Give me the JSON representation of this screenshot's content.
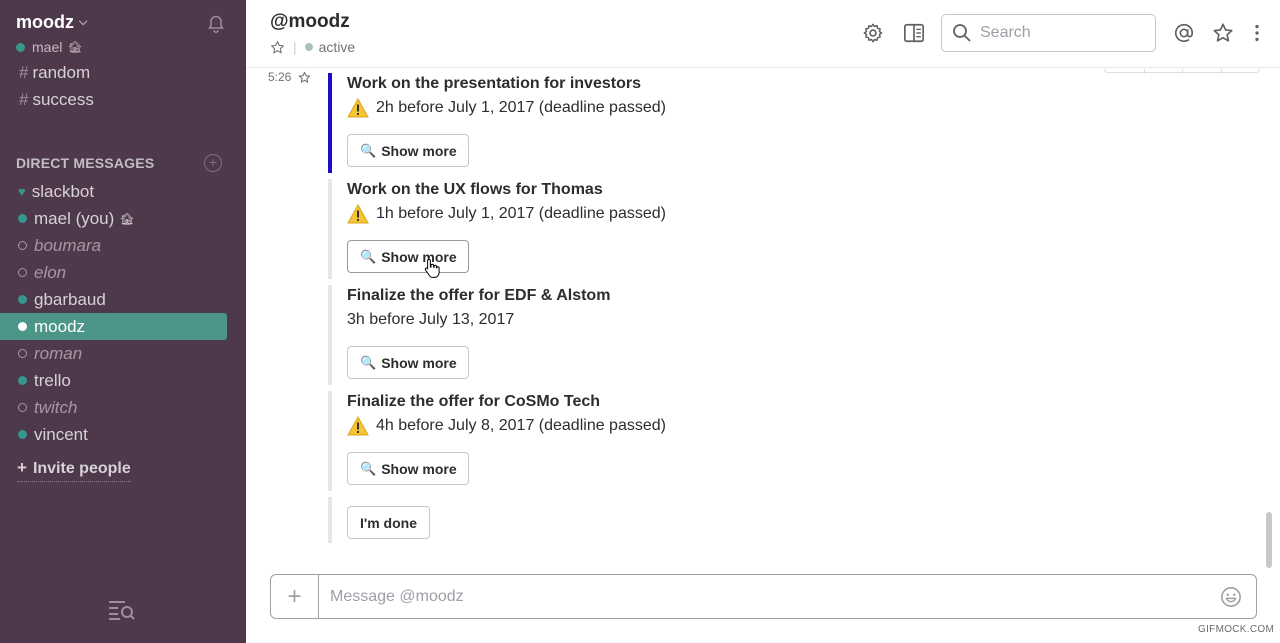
{
  "sidebar": {
    "team_name": "moodz",
    "user_name": "mael",
    "channels": [
      "random",
      "success"
    ],
    "section_title": "DIRECT MESSAGES",
    "dms": [
      {
        "name": "slackbot",
        "status": "bot"
      },
      {
        "name": "mael (you)",
        "status": "online"
      },
      {
        "name": "boumara",
        "status": "away"
      },
      {
        "name": "elon",
        "status": "away"
      },
      {
        "name": "gbarbaud",
        "status": "online"
      },
      {
        "name": "moodz",
        "status": "active"
      },
      {
        "name": "roman",
        "status": "away"
      },
      {
        "name": "trello",
        "status": "online"
      },
      {
        "name": "twitch",
        "status": "away"
      },
      {
        "name": "vincent",
        "status": "online"
      }
    ],
    "invite_label": "Invite people"
  },
  "header": {
    "title": "@moodz",
    "presence": "active",
    "search_placeholder": "Search"
  },
  "messages": {
    "timestamp": "5:26",
    "attachments": [
      {
        "title": "Work on the presentation for investors",
        "text": "2h before July 1, 2017 (deadline passed)",
        "warning": true,
        "button": "Show more"
      },
      {
        "title": "Work on the UX flows for Thomas",
        "text": "1h before July 1, 2017 (deadline passed)",
        "warning": true,
        "button": "Show more"
      },
      {
        "title": "Finalize the offer for EDF & Alstom",
        "text": "3h before July 13, 2017",
        "warning": false,
        "button": "Show more"
      },
      {
        "title": "Finalize the offer for CoSMo Tech",
        "text": "4h before July 8, 2017 (deadline passed)",
        "warning": true,
        "button": "Show more"
      }
    ],
    "done_button": "I'm done"
  },
  "composer": {
    "placeholder": "Message @moodz"
  },
  "watermark": "GIFMOCK.COM",
  "colors": {
    "sidebar_bg": "#4d394b",
    "active_item": "#4c9689",
    "online": "#38978d",
    "attachment_accent": "#1c0bc9"
  }
}
